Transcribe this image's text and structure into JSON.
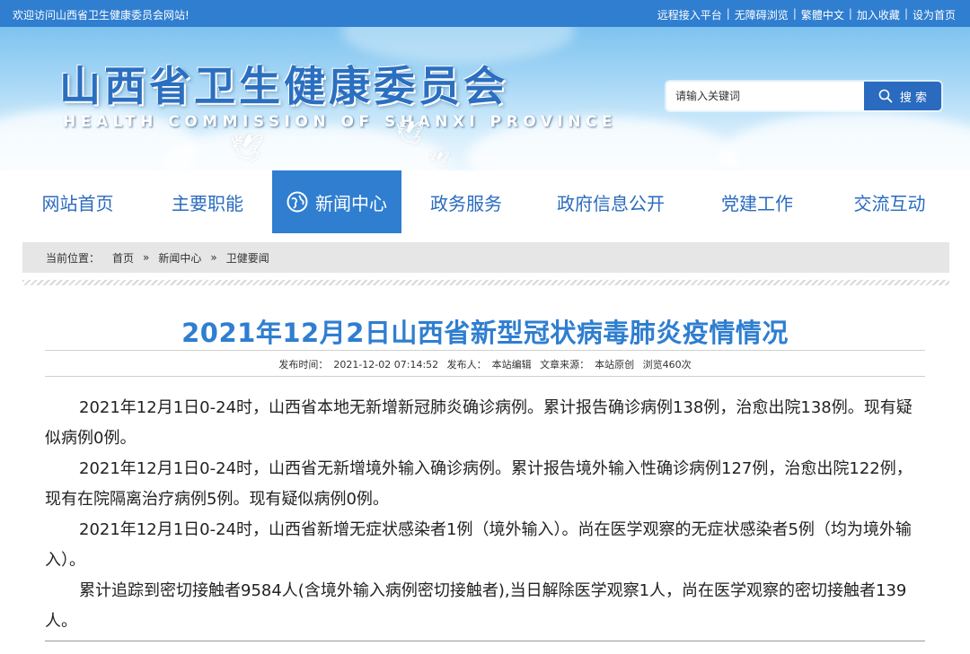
{
  "topbar": {
    "welcome": "欢迎访问山西省卫生健康委员会网站!",
    "links": [
      "远程接入平台",
      "无障碍浏览",
      "繁體中文",
      "加入收藏",
      "设为首页"
    ]
  },
  "header": {
    "logo_cn": "山西省卫生健康委员会",
    "logo_en": "HEALTH COMMISSION OF SHANXI PROVINCE",
    "search": {
      "placeholder": "请输入关键词",
      "button_label": "搜 索"
    }
  },
  "nav": {
    "items": [
      {
        "label": "网站首页",
        "active": false
      },
      {
        "label": "主要职能",
        "active": false
      },
      {
        "label": "新闻中心",
        "active": true
      },
      {
        "label": "政务服务",
        "active": false
      },
      {
        "label": "政府信息公开",
        "active": false
      },
      {
        "label": "党建工作",
        "active": false
      },
      {
        "label": "交流互动",
        "active": false
      }
    ]
  },
  "breadcrumb": {
    "label": "当前位置：",
    "items": [
      "首页",
      "新闻中心",
      "卫健要闻"
    ],
    "separator": "»"
  },
  "article": {
    "title": "2021年12月2日山西省新型冠状病毒肺炎疫情情况",
    "meta": {
      "publish_time_label": "发布时间：",
      "publish_time": "2021-12-02 07:14:52",
      "publisher_label": "发布人：",
      "publisher": "本站编辑",
      "source_label": "文章来源：",
      "source": "本站原创",
      "views": "浏览460次"
    },
    "paragraphs": [
      "2021年12月1日0-24时，山西省本地无新增新冠肺炎确诊病例。累计报告确诊病例138例，治愈出院138例。现有疑似病例0例。",
      "2021年12月1日0-24时，山西省无新增境外输入确诊病例。累计报告境外输入性确诊病例127例，治愈出院122例，现有在院隔离治疗病例5例。现有疑似病例0例。",
      "2021年12月1日0-24时，山西省新增无症状感染者1例（境外输入）。尚在医学观察的无症状感染者5例（均为境外输入）。",
      "累计追踪到密切接触者9584人(含境外输入病例密切接触者),当日解除医学观察1人，尚在医学观察的密切接触者139人。"
    ]
  },
  "colors": {
    "brand_blue": "#2f7ed0",
    "nav_text": "#2a6bbf",
    "title": "#2f7ed0"
  }
}
